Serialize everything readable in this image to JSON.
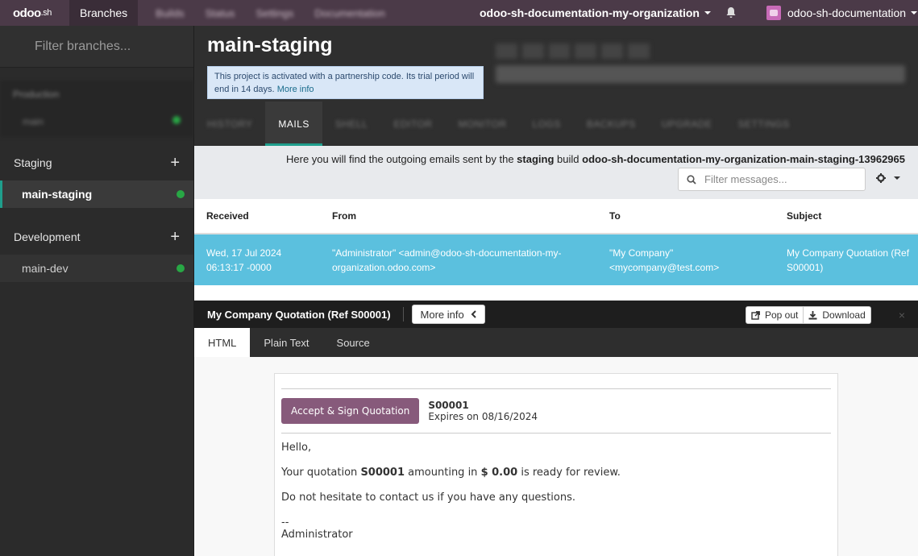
{
  "topbar": {
    "logo": "odoo",
    "logo_suffix": ".sh",
    "nav_branches": "Branches",
    "nav_blurred": [
      "Builds",
      "Status",
      "Settings",
      "Documentation"
    ],
    "project": "odoo-sh-documentation-my-organization",
    "user": "odoo-sh-documentation"
  },
  "sidebar": {
    "filter_placeholder": "Filter branches...",
    "production_label": "Production",
    "production_branch": "main",
    "staging_label": "Staging",
    "staging_branch": "main-staging",
    "development_label": "Development",
    "development_branch": "main-dev"
  },
  "header": {
    "title": "main-staging",
    "notice": "This project is activated with a partnership code. Its trial period will end in 14 days.",
    "notice_link": "More info",
    "tabs": [
      "HISTORY",
      "MAILS",
      "SHELL",
      "EDITOR",
      "MONITOR",
      "LOGS",
      "BACKUPS",
      "UPGRADE",
      "SETTINGS"
    ],
    "active_tab": "MAILS"
  },
  "mails": {
    "info_prefix": "Here you will find the outgoing emails sent by the",
    "info_type": "staging",
    "info_mid": "build",
    "info_build": "odoo-sh-documentation-my-organization-main-staging-13962965",
    "search_placeholder": "Filter messages...",
    "columns": [
      "Received",
      "From",
      "To",
      "Subject"
    ],
    "row": {
      "received": "Wed, 17 Jul 2024 06:13:17 -0000",
      "from": "\"Administrator\" <admin@odoo-sh-documentation-my-organization.odoo.com>",
      "to": "\"My Company\" <mycompany@test.com>",
      "subject": "My Company Quotation (Ref S00001)"
    }
  },
  "detail": {
    "title": "My Company Quotation (Ref S00001)",
    "more_info": "More info",
    "pop_out": "Pop out",
    "download": "Download",
    "view_tabs": [
      "HTML",
      "Plain Text",
      "Source"
    ]
  },
  "email": {
    "accept_button": "Accept & Sign Quotation",
    "ref": "S00001",
    "expires": "Expires on 08/16/2024",
    "greeting": "Hello,",
    "line1_a": "Your quotation",
    "line1_ref": "S00001",
    "line1_b": "amounting in",
    "line1_amount": "$ 0.00",
    "line1_c": "is ready for review.",
    "line2": "Do not hesitate to contact us if you have any questions.",
    "sig_sep": "--",
    "signature": "Administrator"
  }
}
